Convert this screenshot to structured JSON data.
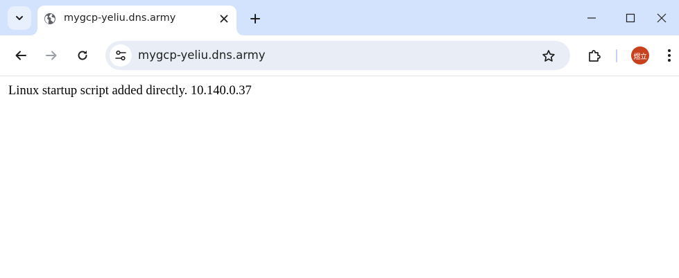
{
  "browser": {
    "tab": {
      "title": "mygcp-yeliu.dns.army",
      "favicon": "globe-icon"
    },
    "address_bar": {
      "url": "mygcp-yeliu.dns.army"
    },
    "profile": {
      "avatar_text": "煜立",
      "avatar_color": "#c7411e"
    },
    "colors": {
      "tabstrip_bg": "#d3e3fd",
      "omnibox_bg": "#e9eef6"
    }
  },
  "page": {
    "body_text": "Linux startup script added directly. 10.140.0.37"
  }
}
